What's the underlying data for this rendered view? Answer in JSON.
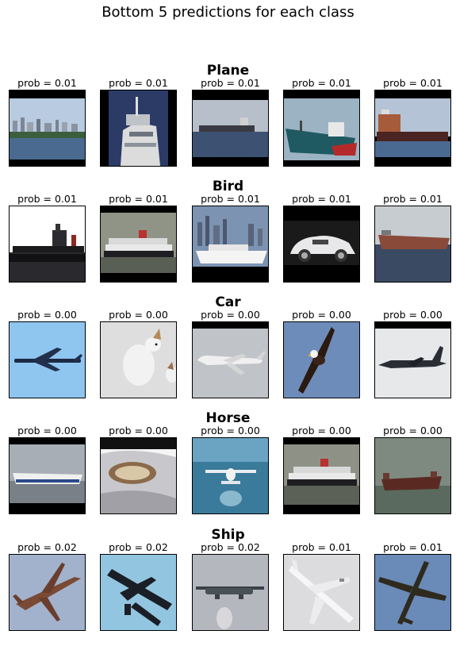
{
  "title": "Bottom 5 predictions for each class",
  "rows": [
    {
      "class": "Plane",
      "cells": [
        {
          "prob": "prob = 0.01",
          "scene": "ship-city"
        },
        {
          "prob": "prob = 0.01",
          "scene": "ship-bridge"
        },
        {
          "prob": "prob = 0.01",
          "scene": "tanker-sea"
        },
        {
          "prob": "prob = 0.01",
          "scene": "ship-teal"
        },
        {
          "prob": "prob = 0.01",
          "scene": "cargo-ship"
        }
      ]
    },
    {
      "class": "Bird",
      "cells": [
        {
          "prob": "prob = 0.01",
          "scene": "tanker-dark"
        },
        {
          "prob": "prob = 0.01",
          "scene": "cruise-ship"
        },
        {
          "prob": "prob = 0.01",
          "scene": "ferry-city"
        },
        {
          "prob": "prob = 0.01",
          "scene": "car-white"
        },
        {
          "prob": "prob = 0.01",
          "scene": "barge"
        }
      ]
    },
    {
      "class": "Car",
      "cells": [
        {
          "prob": "prob = 0.00",
          "scene": "plane-blue-sky"
        },
        {
          "prob": "prob = 0.00",
          "scene": "dog-snow"
        },
        {
          "prob": "prob = 0.00",
          "scene": "jet-landing"
        },
        {
          "prob": "prob = 0.00",
          "scene": "eagle"
        },
        {
          "prob": "prob = 0.00",
          "scene": "harrier"
        }
      ]
    },
    {
      "class": "Horse",
      "cells": [
        {
          "prob": "prob = 0.00",
          "scene": "ferry-grey"
        },
        {
          "prob": "prob = 0.00",
          "scene": "car-headlight"
        },
        {
          "prob": "prob = 0.00",
          "scene": "seaplane"
        },
        {
          "prob": "prob = 0.00",
          "scene": "cruise-ship-2"
        },
        {
          "prob": "prob = 0.00",
          "scene": "ship-fog"
        }
      ]
    },
    {
      "class": "Ship",
      "cells": [
        {
          "prob": "prob = 0.02",
          "scene": "airliner-orange"
        },
        {
          "prob": "prob = 0.02",
          "scene": "bomber"
        },
        {
          "prob": "prob = 0.02",
          "scene": "transport-plane"
        },
        {
          "prob": "prob = 0.01",
          "scene": "white-jet"
        },
        {
          "prob": "prob = 0.01",
          "scene": "jet-overhead"
        }
      ]
    }
  ]
}
